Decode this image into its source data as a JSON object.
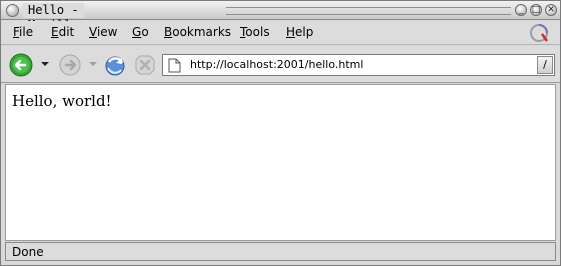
{
  "window": {
    "title": "Hello - Mozilla Firefox"
  },
  "window_controls": {
    "minimize_glyph": "_",
    "maximize_glyph": "□",
    "close_glyph": "✕"
  },
  "menubar": {
    "items": [
      {
        "underline": "F",
        "rest": "ile"
      },
      {
        "underline": "E",
        "rest": "dit"
      },
      {
        "underline": "V",
        "rest": "iew"
      },
      {
        "underline": "G",
        "rest": "o"
      },
      {
        "underline": "B",
        "rest": "ookmarks"
      },
      {
        "underline": "T",
        "rest": "ools"
      },
      {
        "underline": "H",
        "rest": "elp"
      }
    ]
  },
  "navbar": {
    "url": "http://localhost:2001/hello.html",
    "go_glyph": "/"
  },
  "page": {
    "body_text": "Hello, world!"
  },
  "status": {
    "text": "Done"
  },
  "colors": {
    "chrome": "#dcdcdc",
    "back_arrow": "#2e9a2e",
    "content_bg": "#ffffff"
  }
}
